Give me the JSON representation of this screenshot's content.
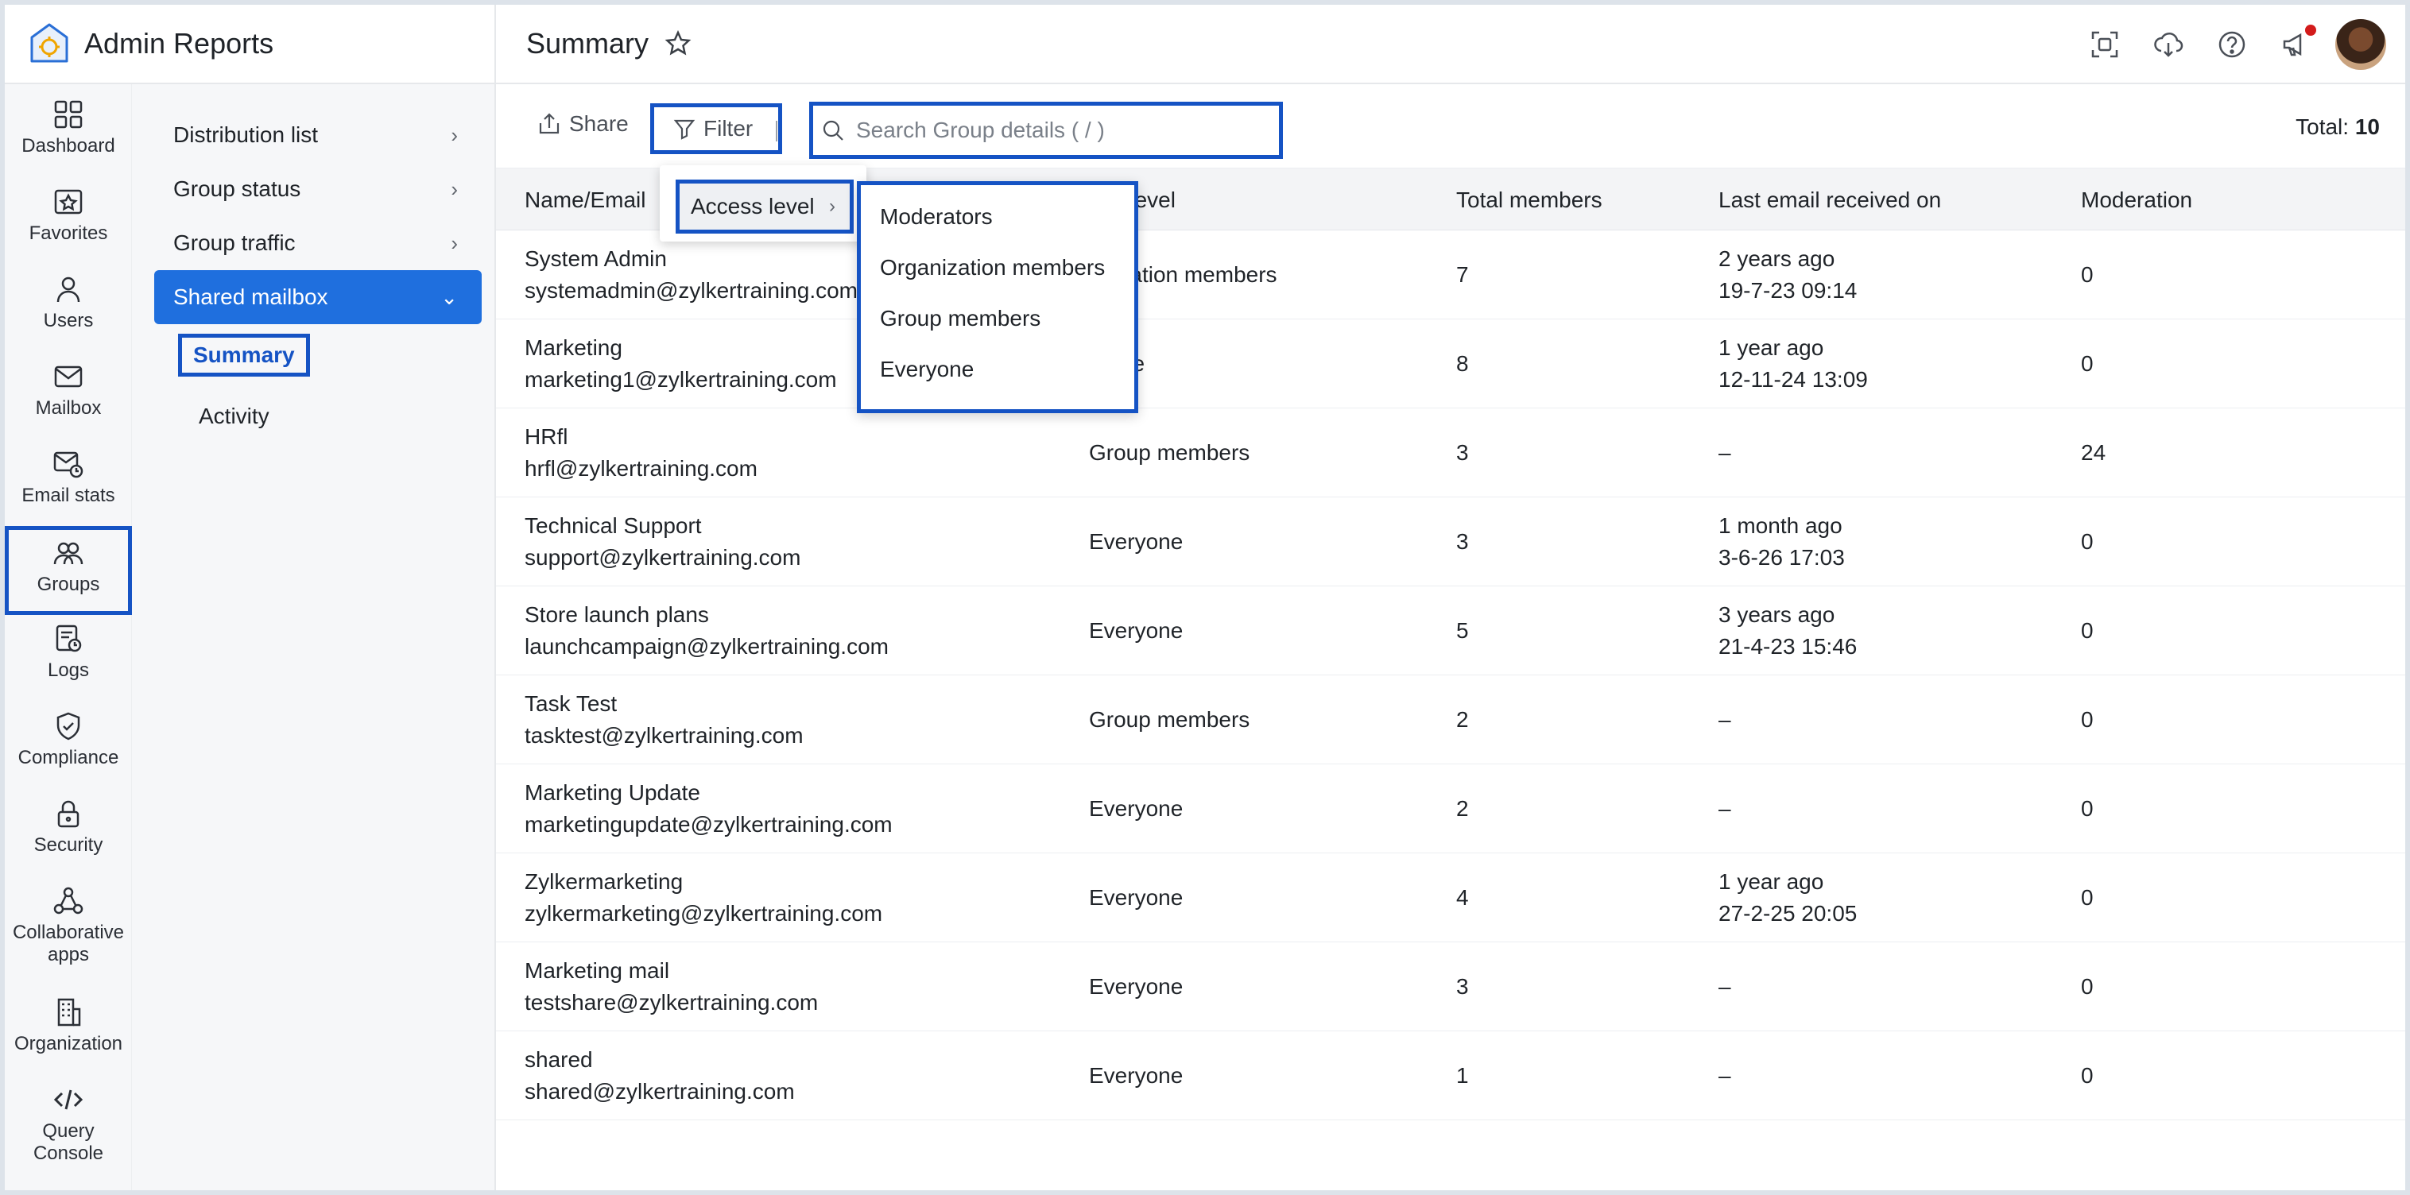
{
  "app": {
    "title": "Admin Reports"
  },
  "header": {
    "page_title": "Summary"
  },
  "rail": [
    {
      "label": "Dashboard",
      "icon": "dashboard-icon"
    },
    {
      "label": "Favorites",
      "icon": "favorites-icon"
    },
    {
      "label": "Users",
      "icon": "users-icon"
    },
    {
      "label": "Mailbox",
      "icon": "mailbox-icon"
    },
    {
      "label": "Email stats",
      "icon": "email-stats-icon"
    },
    {
      "label": "Groups",
      "icon": "groups-icon",
      "active": true
    },
    {
      "label": "Logs",
      "icon": "logs-icon"
    },
    {
      "label": "Compliance",
      "icon": "compliance-icon"
    },
    {
      "label": "Security",
      "icon": "security-icon"
    },
    {
      "label_line1": "Collaborative",
      "label_line2": "apps",
      "icon": "collaborative-apps-icon"
    },
    {
      "label": "Organization",
      "icon": "organization-icon"
    },
    {
      "label_line1": "Query",
      "label_line2": "Console",
      "icon": "query-console-icon"
    }
  ],
  "subnav": {
    "items": [
      "Distribution list",
      "Group status",
      "Group traffic",
      "Shared mailbox"
    ],
    "sub_items": [
      "Summary",
      "Activity"
    ]
  },
  "toolbar": {
    "share_label": "Share",
    "filter_label": "Filter",
    "search_placeholder": "Search Group details ( / )",
    "total_label": "Total:",
    "total_value": "10"
  },
  "filter_menu": {
    "access_level_label": "Access level",
    "options": [
      "Moderators",
      "Organization members",
      "Group members",
      "Everyone"
    ]
  },
  "table": {
    "headers": [
      "Name/Email",
      "Access level",
      "Total members",
      "Last email received on",
      "Moderation"
    ],
    "visible_access_header": "ess level",
    "rows": [
      {
        "name": "System Admin",
        "email": "systemadmin@zylkertraining.com",
        "access": "anization members",
        "total": "7",
        "last1": "2 years ago",
        "last2": "19-7-23 09:14",
        "moderation": "0"
      },
      {
        "name": "Marketing",
        "email": "marketing1@zylkertraining.com",
        "access": "ryone",
        "total": "8",
        "last1": "1 year ago",
        "last2": "12-11-24 13:09",
        "moderation": "0"
      },
      {
        "name": "HRfl",
        "email": "hrfl@zylkertraining.com",
        "access": "Group members",
        "total": "3",
        "last1": "–",
        "last2": "",
        "moderation": "24"
      },
      {
        "name": "Technical Support",
        "email": "support@zylkertraining.com",
        "access": "Everyone",
        "total": "3",
        "last1": "1 month ago",
        "last2": "3-6-26 17:03",
        "moderation": "0"
      },
      {
        "name": "Store launch plans",
        "email": "launchcampaign@zylkertraining.com",
        "access": "Everyone",
        "total": "5",
        "last1": "3 years ago",
        "last2": "21-4-23 15:46",
        "moderation": "0"
      },
      {
        "name": "Task Test",
        "email": "tasktest@zylkertraining.com",
        "access": "Group members",
        "total": "2",
        "last1": "–",
        "last2": "",
        "moderation": "0"
      },
      {
        "name": "Marketing Update",
        "email": "marketingupdate@zylkertraining.com",
        "access": "Everyone",
        "total": "2",
        "last1": "–",
        "last2": "",
        "moderation": "0"
      },
      {
        "name": "Zylkermarketing",
        "email": "zylkermarketing@zylkertraining.com",
        "access": "Everyone",
        "total": "4",
        "last1": "1 year ago",
        "last2": "27-2-25 20:05",
        "moderation": "0"
      },
      {
        "name": "Marketing mail",
        "email": "testshare@zylkertraining.com",
        "access": "Everyone",
        "total": "3",
        "last1": "–",
        "last2": "",
        "moderation": "0"
      },
      {
        "name": "shared",
        "email": "shared@zylkertraining.com",
        "access": "Everyone",
        "total": "1",
        "last1": "–",
        "last2": "",
        "moderation": "0"
      }
    ]
  },
  "colors": {
    "accent": "#1553c4",
    "active_nav": "#1f6fde",
    "notification": "#d31b1b"
  }
}
